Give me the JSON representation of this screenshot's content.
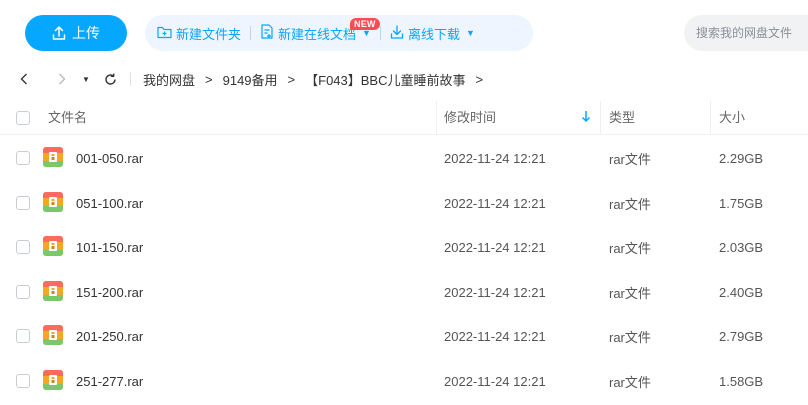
{
  "toolbar": {
    "upload_label": "上传",
    "new_folder_label": "新建文件夹",
    "new_online_doc_label": "新建在线文档",
    "new_badge": "NEW",
    "offline_download_label": "离线下载",
    "search_placeholder": "搜索我的网盘文件"
  },
  "breadcrumb": {
    "items": [
      "我的网盘",
      "9149备用",
      "【F043】BBC儿童睡前故事"
    ],
    "separator": ">"
  },
  "table": {
    "headers": {
      "name": "文件名",
      "modified": "修改时间",
      "type": "类型",
      "size": "大小"
    },
    "rows": [
      {
        "name": "001-050.rar",
        "modified": "2022-11-24 12:21",
        "type": "rar文件",
        "size": "2.29GB"
      },
      {
        "name": "051-100.rar",
        "modified": "2022-11-24 12:21",
        "type": "rar文件",
        "size": "1.75GB"
      },
      {
        "name": "101-150.rar",
        "modified": "2022-11-24 12:21",
        "type": "rar文件",
        "size": "2.03GB"
      },
      {
        "name": "151-200.rar",
        "modified": "2022-11-24 12:21",
        "type": "rar文件",
        "size": "2.40GB"
      },
      {
        "name": "201-250.rar",
        "modified": "2022-11-24 12:21",
        "type": "rar文件",
        "size": "2.79GB"
      },
      {
        "name": "251-277.rar",
        "modified": "2022-11-24 12:21",
        "type": "rar文件",
        "size": "1.58GB"
      }
    ]
  },
  "colors": {
    "accent": "#06a7ff",
    "tool_bg": "#eef5fe",
    "badge": "#ff4d4f",
    "archive_icon": "#f5a623"
  }
}
